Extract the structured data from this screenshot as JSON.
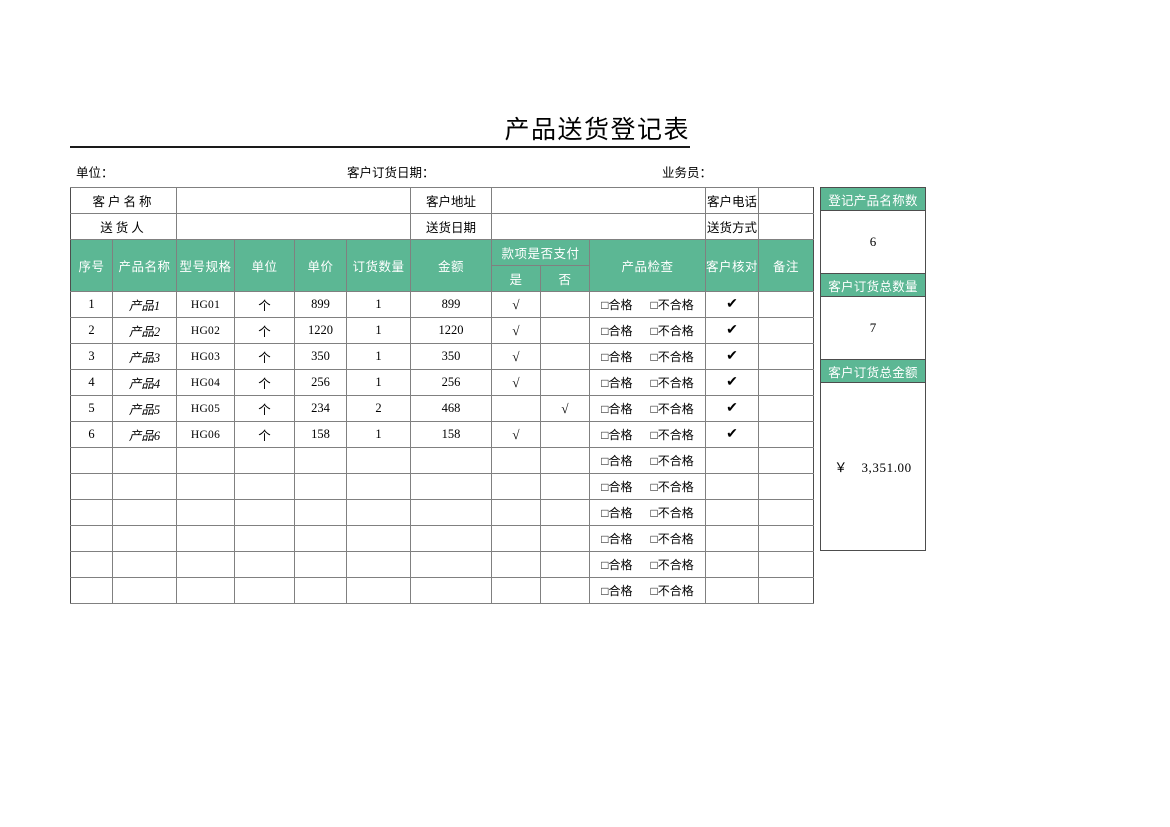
{
  "document": {
    "title": "产品送货登记表"
  },
  "top_labels": {
    "unit": "单位：",
    "order_date": "客户订货日期：",
    "salesperson": "业务员："
  },
  "info_block": {
    "rows": [
      {
        "label1": "客户名称",
        "value1": "",
        "label2": "客户地址",
        "value2": "",
        "label3": "客户电话",
        "value3": ""
      },
      {
        "label1": "送货人",
        "value1": "",
        "label2": "送货日期",
        "value2": "",
        "label3": "送货方式",
        "value3": ""
      }
    ]
  },
  "table": {
    "headers": {
      "index": "序号",
      "product_name": "产品名称",
      "model_spec": "型号规格",
      "unit": "单位",
      "unit_price": "单价",
      "order_qty": "订货数量",
      "amount": "金额",
      "payment_group": "款项是否支付",
      "payment_yes": "是",
      "payment_no": "否",
      "inspection": "产品检查",
      "customer_check": "客户核对",
      "remark": "备注"
    },
    "inspection_options": {
      "pass": "□合格",
      "fail": "□不合格"
    },
    "check_mark": "√",
    "check_mark_bold": "✔",
    "rows": [
      {
        "index": "1",
        "product_name": "产品1",
        "model_spec": "HG01",
        "unit": "个",
        "unit_price": "899",
        "order_qty": "1",
        "amount": "899",
        "paid_yes": "√",
        "paid_no": "",
        "customer_check": "✔",
        "remark": ""
      },
      {
        "index": "2",
        "product_name": "产品2",
        "model_spec": "HG02",
        "unit": "个",
        "unit_price": "1220",
        "order_qty": "1",
        "amount": "1220",
        "paid_yes": "√",
        "paid_no": "",
        "customer_check": "✔",
        "remark": ""
      },
      {
        "index": "3",
        "product_name": "产品3",
        "model_spec": "HG03",
        "unit": "个",
        "unit_price": "350",
        "order_qty": "1",
        "amount": "350",
        "paid_yes": "√",
        "paid_no": "",
        "customer_check": "✔",
        "remark": ""
      },
      {
        "index": "4",
        "product_name": "产品4",
        "model_spec": "HG04",
        "unit": "个",
        "unit_price": "256",
        "order_qty": "1",
        "amount": "256",
        "paid_yes": "√",
        "paid_no": "",
        "customer_check": "✔",
        "remark": ""
      },
      {
        "index": "5",
        "product_name": "产品5",
        "model_spec": "HG05",
        "unit": "个",
        "unit_price": "234",
        "order_qty": "2",
        "amount": "468",
        "paid_yes": "",
        "paid_no": "√",
        "customer_check": "✔",
        "remark": ""
      },
      {
        "index": "6",
        "product_name": "产品6",
        "model_spec": "HG06",
        "unit": "个",
        "unit_price": "158",
        "order_qty": "1",
        "amount": "158",
        "paid_yes": "√",
        "paid_no": "",
        "customer_check": "✔",
        "remark": ""
      },
      {
        "index": "",
        "product_name": "",
        "model_spec": "",
        "unit": "",
        "unit_price": "",
        "order_qty": "",
        "amount": "",
        "paid_yes": "",
        "paid_no": "",
        "customer_check": "",
        "remark": ""
      },
      {
        "index": "",
        "product_name": "",
        "model_spec": "",
        "unit": "",
        "unit_price": "",
        "order_qty": "",
        "amount": "",
        "paid_yes": "",
        "paid_no": "",
        "customer_check": "",
        "remark": ""
      },
      {
        "index": "",
        "product_name": "",
        "model_spec": "",
        "unit": "",
        "unit_price": "",
        "order_qty": "",
        "amount": "",
        "paid_yes": "",
        "paid_no": "",
        "customer_check": "",
        "remark": ""
      },
      {
        "index": "",
        "product_name": "",
        "model_spec": "",
        "unit": "",
        "unit_price": "",
        "order_qty": "",
        "amount": "",
        "paid_yes": "",
        "paid_no": "",
        "customer_check": "",
        "remark": ""
      },
      {
        "index": "",
        "product_name": "",
        "model_spec": "",
        "unit": "",
        "unit_price": "",
        "order_qty": "",
        "amount": "",
        "paid_yes": "",
        "paid_no": "",
        "customer_check": "",
        "remark": ""
      },
      {
        "index": "",
        "product_name": "",
        "model_spec": "",
        "unit": "",
        "unit_price": "",
        "order_qty": "",
        "amount": "",
        "paid_yes": "",
        "paid_no": "",
        "customer_check": "",
        "remark": ""
      }
    ]
  },
  "summary_panel": {
    "blocks": [
      {
        "label": "登记产品名称数",
        "value": "6"
      },
      {
        "label": "客户订货总数量",
        "value": "7"
      },
      {
        "label": "客户订货总金额",
        "value": "￥　3,351.00"
      }
    ]
  },
  "colors": {
    "header_green": "#5cb794",
    "grid_gray": "#808080",
    "outer_border": "#4d4d4d",
    "text": "#000000"
  }
}
